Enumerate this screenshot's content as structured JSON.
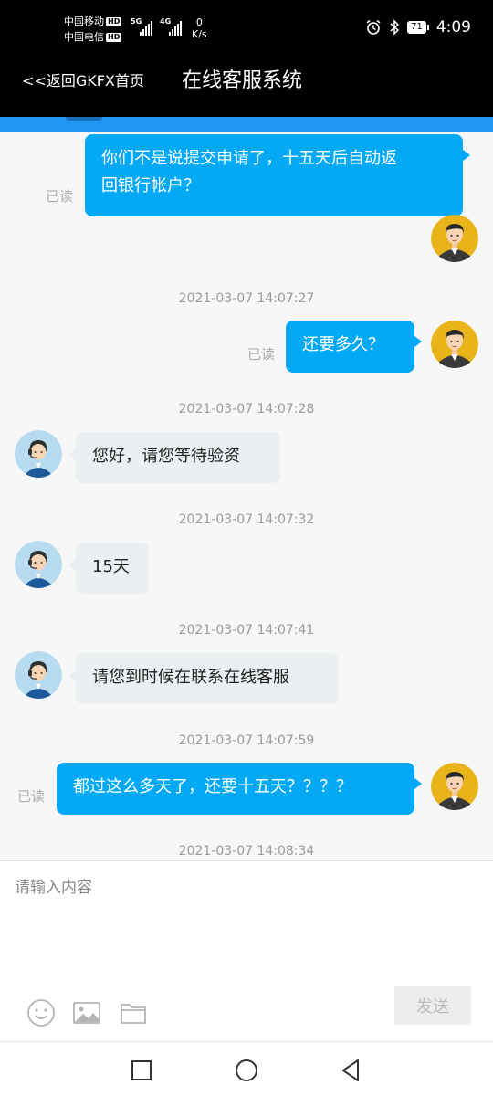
{
  "status_bar": {
    "carrier_1": "中国移动",
    "carrier_2": "中国电信",
    "hd_badge": "HD",
    "network_1": "5G",
    "network_2": "4G",
    "speed_value": "0",
    "speed_unit": "K/s",
    "battery_level": "71",
    "time": "4:09",
    "icons": [
      "alarm-icon",
      "bluetooth-icon",
      "battery-icon"
    ]
  },
  "header": {
    "back_link": "<<返回GKFX首页",
    "title": "在线客服系统"
  },
  "messages": [
    {
      "type": "outgoing",
      "text": "你们不是说提交申请了，十五天后自动返\n回银行帐户？",
      "status": "已读"
    },
    {
      "type": "timestamp",
      "text": "2021-03-07 14:07:27"
    },
    {
      "type": "outgoing",
      "text": "还要多久？",
      "status": "已读"
    },
    {
      "type": "timestamp",
      "text": "2021-03-07 14:07:28"
    },
    {
      "type": "incoming",
      "text": "您好，请您等待验资"
    },
    {
      "type": "timestamp",
      "text": "2021-03-07 14:07:32"
    },
    {
      "type": "incoming",
      "text": "15天"
    },
    {
      "type": "timestamp",
      "text": "2021-03-07 14:07:41"
    },
    {
      "type": "incoming",
      "text": "请您到时候在联系在线客服"
    },
    {
      "type": "timestamp",
      "text": "2021-03-07 14:07:59"
    },
    {
      "type": "outgoing",
      "text": "都过这么多天了，还要十五天？？？？",
      "status": "已读"
    },
    {
      "type": "timestamp",
      "text": "2021-03-07 14:08:34"
    }
  ],
  "composer": {
    "placeholder": "请输入内容",
    "value": "",
    "send_label": "发送",
    "tools": [
      "emoji-icon",
      "image-icon",
      "folder-icon"
    ]
  },
  "nav_bar": {
    "buttons": [
      "recent-apps-icon",
      "home-icon",
      "back-icon"
    ]
  },
  "colors": {
    "outgoing_bubble": "#03a9f4",
    "incoming_bubble": "#eaeff1",
    "accent_strip": "#2196f3",
    "chat_background": "#f7f7f7"
  }
}
